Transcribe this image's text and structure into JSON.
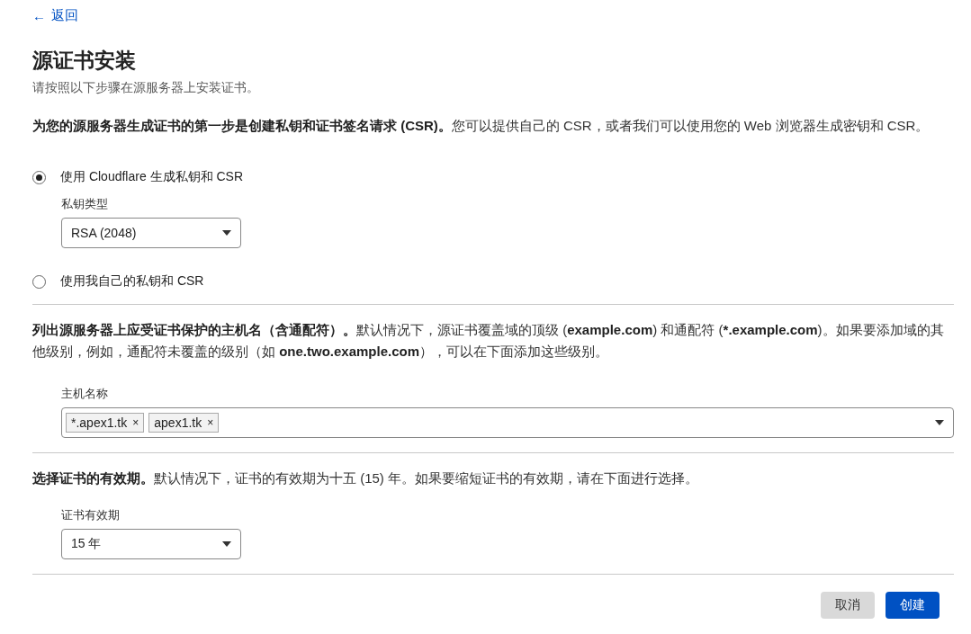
{
  "back_link": {
    "icon": "←",
    "label": "返回"
  },
  "title": "源证书安装",
  "subtitle": "请按照以下步骤在源服务器上安装证书。",
  "sections": [
    {
      "kind": "key",
      "intro": "**为您的源服务器生成证书的第一步是创建私钥和证书签名请求 (CSR)。**您可以提供自己的 CSR，或者我们可以使用您的 Web 浏览器生成密钥和 CSR。",
      "options": [
        {
          "label": "使用 Cloudflare 生成私钥和 CSR",
          "selected": true,
          "field": {
            "label": "私钥类型",
            "value": "RSA (2048)"
          }
        },
        {
          "label": "使用我自己的私钥和 CSR",
          "selected": false
        }
      ]
    },
    {
      "kind": "hosts",
      "intro": "**列出源服务器上应受证书保护的主机名（含通配符）。**默认情况下，源证书覆盖域的顶级 (**example.com**) 和通配符 (***.example.com**)。如果要添加域的其他级别，例如，通配符未覆盖的级别（如 **one.two.example.com**），可以在下面添加这些级别。",
      "field": {
        "label": "主机名称",
        "tags": [
          {
            "label": "*.apex1.tk",
            "remove": "×"
          },
          {
            "label": "apex1.tk",
            "remove": "×"
          }
        ]
      }
    },
    {
      "kind": "validity",
      "intro": "**选择证书的有效期。**默认情况下，证书的有效期为十五 (15) 年。如果要缩短证书的有效期，请在下面进行选择。",
      "field": {
        "label": "证书有效期",
        "value": "15 年"
      }
    }
  ],
  "buttons": [
    {
      "label": "取消",
      "kind": "secondary"
    },
    {
      "label": "创建",
      "kind": "primary"
    }
  ]
}
